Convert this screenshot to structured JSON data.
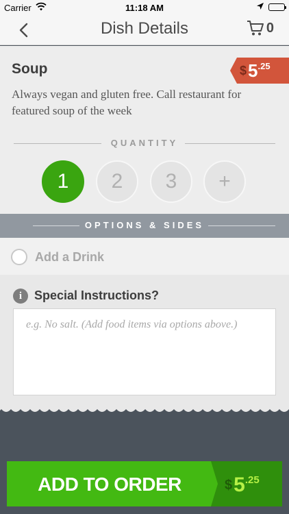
{
  "status_bar": {
    "carrier": "Carrier",
    "time": "11:18 AM",
    "wifi_icon": "wifi-icon",
    "location_icon": "location-arrow-icon",
    "battery_icon": "battery-icon"
  },
  "nav": {
    "title": "Dish Details",
    "back_icon": "chevron-left-icon",
    "cart_icon": "cart-icon",
    "cart_count": "0"
  },
  "dish": {
    "name": "Soup",
    "price_currency": "$",
    "price_dollars": "5",
    "price_cents": ".25",
    "description": "Always vegan and gluten free. Call restaurant for featured soup of the week"
  },
  "quantity": {
    "label": "QUANTITY",
    "options": [
      "1",
      "2",
      "3",
      "+"
    ],
    "selected": "1"
  },
  "options": {
    "header": "OPTIONS & SIDES",
    "add_drink_label": "Add a Drink"
  },
  "instructions": {
    "title": "Special Instructions?",
    "info_icon": "info-icon",
    "placeholder": "e.g. No salt. (Add food items via options above.)"
  },
  "add_to_order": {
    "label": "ADD TO ORDER",
    "currency": "$",
    "dollars": "5",
    "cents": ".25"
  },
  "colors": {
    "accent_green": "#43b912",
    "selected_qty_green": "#3aa510",
    "price_tag_red": "#d2553b",
    "options_header_gray": "#9198a0",
    "footer_slate": "#4b535c"
  }
}
